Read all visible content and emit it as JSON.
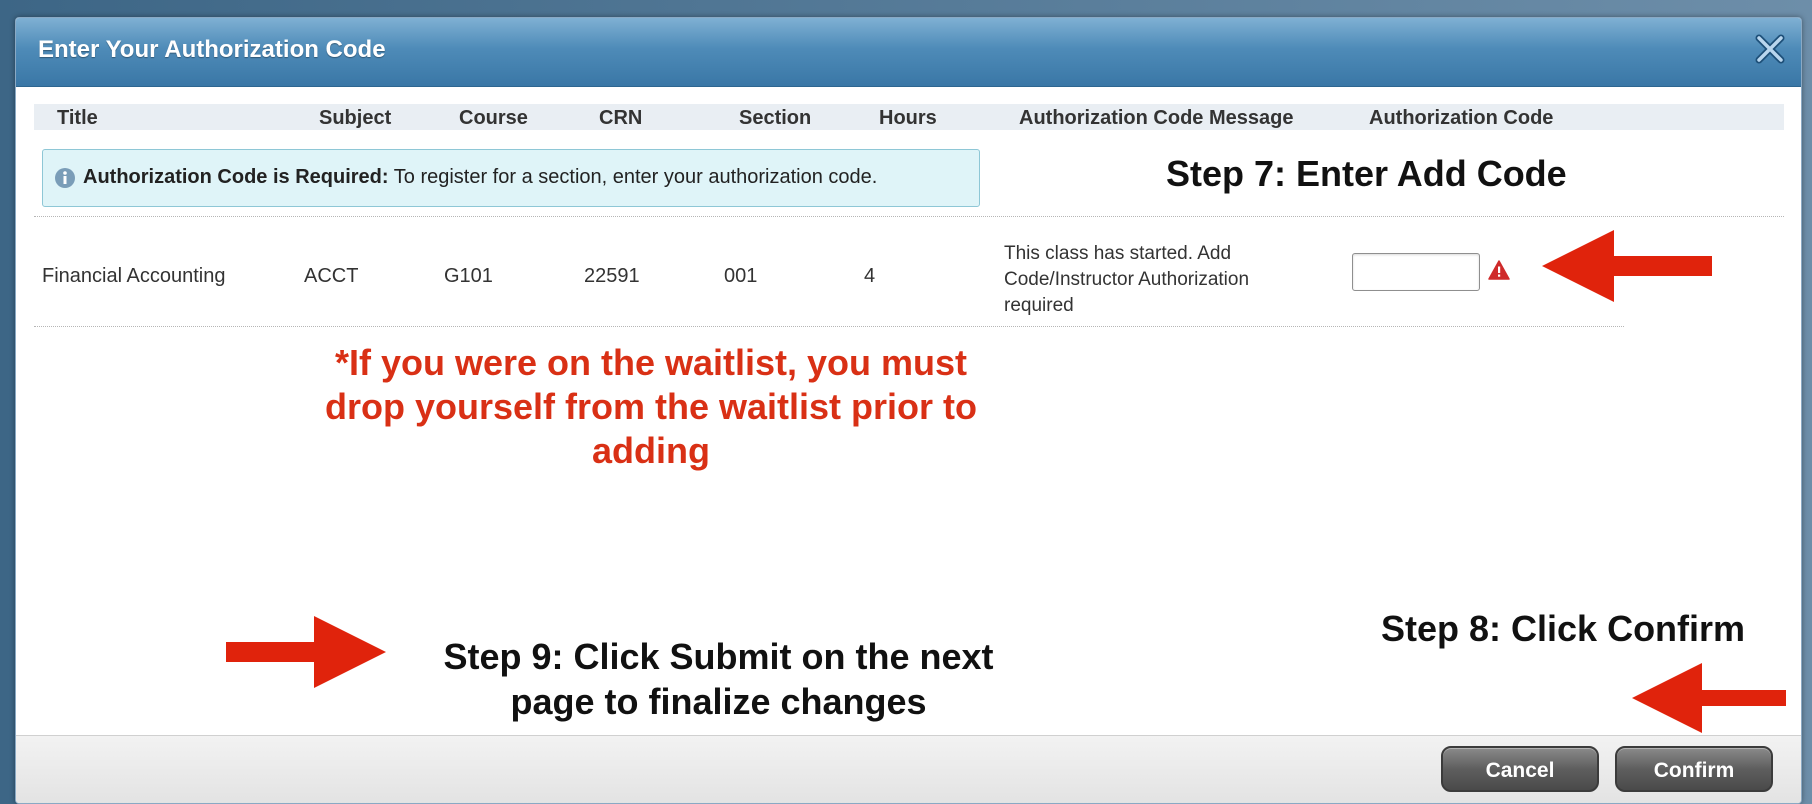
{
  "dialog": {
    "title": "Enter Your Authorization Code",
    "close_icon": "close-x-icon"
  },
  "table": {
    "headers": [
      "Title",
      "Subject",
      "Course",
      "CRN",
      "Section",
      "Hours",
      "Authorization Code Message",
      "Authorization Code"
    ],
    "notice": {
      "icon": "info-icon",
      "bold": "Authorization Code is Required:",
      "text": " To register for a section, enter your authorization code."
    },
    "row": {
      "title": "Financial Accounting",
      "subject": "ACCT",
      "course": "G101",
      "crn": "22591",
      "section": "001",
      "hours": "4",
      "message": "This class has started. Add Code/Instructor Authorization required",
      "auth_code_value": "",
      "warning_icon": "warning-triangle-icon"
    }
  },
  "annotations": {
    "step7": "Step 7: Enter Add Code",
    "waitlist_note": "*If you were on the waitlist, you must drop yourself from the waitlist prior to adding",
    "step8": "Step 8: Click Confirm",
    "step9": "Step 9: Click Submit on the next page to finalize changes",
    "arrow_color": "#e0230c",
    "note_color": "#d93015"
  },
  "footer": {
    "cancel_label": "Cancel",
    "confirm_label": "Confirm"
  },
  "colors": {
    "titlebar": "#4e8bb8",
    "notice_bg": "#dff4f8",
    "header_bg": "#e9eef3"
  }
}
